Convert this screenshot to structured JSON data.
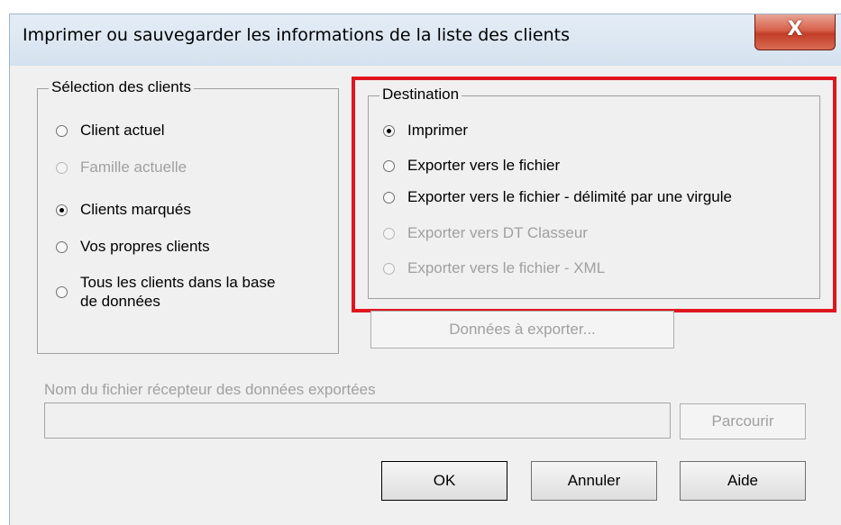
{
  "window": {
    "title": "Imprimer ou sauvegarder les informations de la liste des clients",
    "close_label": "X"
  },
  "client_selection": {
    "legend": "Sélection des clients",
    "options": [
      {
        "label": "Client actuel",
        "checked": false,
        "enabled": true
      },
      {
        "label": "Famille actuelle",
        "checked": false,
        "enabled": false
      },
      {
        "label": "Clients marqués",
        "checked": true,
        "enabled": true
      },
      {
        "label": "Vos propres clients",
        "checked": false,
        "enabled": true
      },
      {
        "label_line1": "Tous les clients dans la base",
        "label_line2": "de données",
        "checked": false,
        "enabled": true
      }
    ]
  },
  "destination": {
    "legend": "Destination",
    "options": [
      {
        "label": "Imprimer",
        "checked": true,
        "enabled": true
      },
      {
        "label": "Exporter vers le fichier",
        "checked": false,
        "enabled": true
      },
      {
        "label": "Exporter vers le fichier - délimité par une virgule",
        "checked": false,
        "enabled": true
      },
      {
        "label": "Exporter vers DT Classeur",
        "checked": false,
        "enabled": false
      },
      {
        "label": "Exporter vers le fichier - XML",
        "checked": false,
        "enabled": false
      }
    ]
  },
  "export_data_button": "Données à exporter...",
  "file_field": {
    "label": "Nom du fichier récepteur des données exportées",
    "value": "",
    "browse_label": "Parcourir"
  },
  "footer": {
    "ok_label": "OK",
    "cancel_label": "Annuler",
    "help_label": "Aide"
  },
  "colors": {
    "highlight_border": "#e0161f",
    "disabled_text": "#a0a0a0",
    "dialog_background": "#f0f0f0"
  }
}
